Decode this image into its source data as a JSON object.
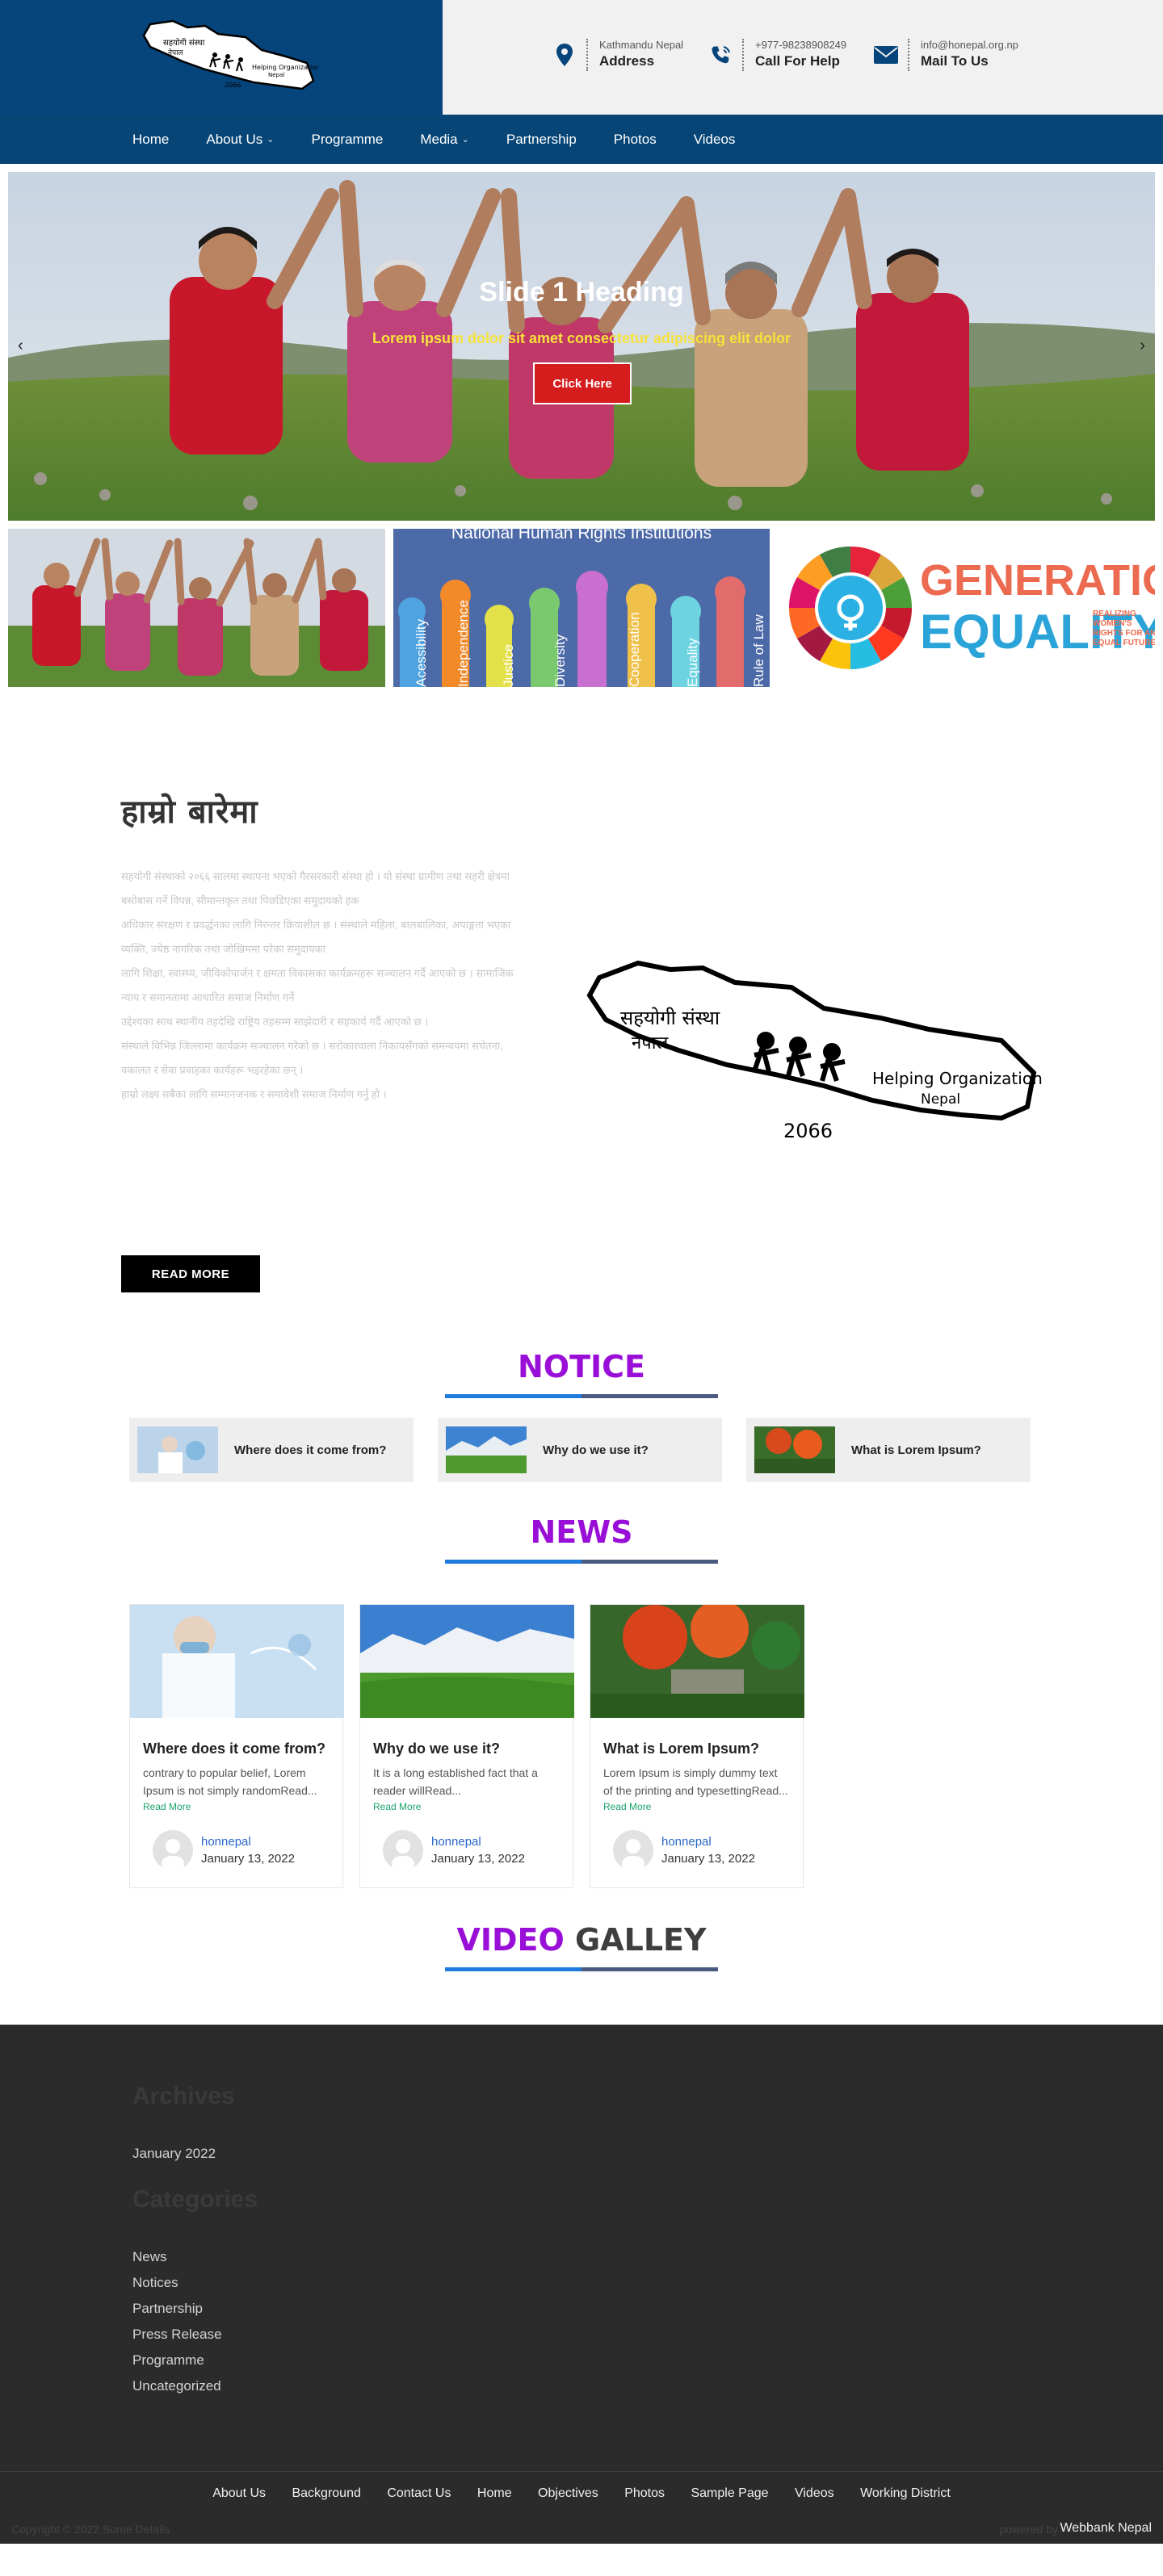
{
  "header": {
    "logo_nepali_line1": "सहयोगी संस्था",
    "logo_nepali_line2": "नेपाल",
    "logo_english": "Helping Organization",
    "logo_english2": "Nepal",
    "logo_year": "2066",
    "contacts": [
      {
        "icon": "map-pin-icon",
        "small": "Kathmandu Nepal",
        "big": "Address"
      },
      {
        "icon": "phone-icon",
        "small": "+977-98238908249",
        "big": "Call For Help"
      },
      {
        "icon": "envelope-icon",
        "small": "info@honepal.org.np",
        "big": "Mail To Us"
      }
    ]
  },
  "nav": {
    "items": [
      "Home",
      "About Us",
      "Programme",
      "Media",
      "Partnership",
      "Photos",
      "Videos"
    ]
  },
  "hero": {
    "title": "Slide 1 Heading",
    "subtitle": "Lorem ipsum dolor sit amet consectetur adipiscing elit dolor",
    "button": "Click Here",
    "prev": "‹",
    "next": "›"
  },
  "thumbs": {
    "nhri_title": "National Human Rights Institutions",
    "nhri_words": [
      "Acessibility",
      "Independence",
      "Justice",
      "Diversity",
      "Cooperation",
      "Equality",
      "Rule of Law"
    ],
    "gen_line1": "GENERATION",
    "gen_line2": "EQUALITY",
    "gen_small": [
      "REALIZING",
      "WOMEN'S",
      "RIGHTS FOR AN",
      "EQUAL FUTURE"
    ]
  },
  "about": {
    "title": "हाम्रो बारेमा",
    "body": [
      "सहयोगी संस्थाको २०६६ सालमा स्थापना भएको गैरसरकारी संस्था हो । यो संस्था ग्रामीण तथा सहरी क्षेत्रमा बसोबास गर्ने विपन्न, सीमान्तकृत तथा पिछडिएका समुदायको हक",
      "अधिकार संरक्षण र प्रवर्द्धनका लागि निरन्तर क्रियाशील छ । संस्थाले महिला, बालबालिका, अपाङ्गता भएका व्यक्ति, ज्येष्ठ नागरिक तथा जोखिममा परेका समुदायका",
      "लागि शिक्षा, स्वास्थ्य, जीविकोपार्जन र क्षमता विकासका कार्यक्रमहरू सञ्चालन गर्दै आएको छ । सामाजिक न्याय र समानतामा आधारित समाज निर्माण गर्ने",
      "उद्देश्यका साथ स्थानीय तहदेखि राष्ट्रिय तहसम्म साझेदारी र सहकार्य गर्दै आएको छ ।",
      "संस्थाले विभिन्न जिल्लामा कार्यक्रम सञ्चालन गरेको छ । सरोकारवाला निकायसँगको समन्वयमा सचेतना, वकालत र सेवा प्रवाहका कार्यहरू भइरहेका छन् ।",
      "हाम्रो लक्ष्य सबैका लागि सम्मानजनक र समावेशी समाज निर्माण गर्नु हो ।"
    ],
    "button": "READ MORE"
  },
  "notice": {
    "title_part1": "NOTICE",
    "items": [
      {
        "title": "Where does it come from?",
        "image": "doctor"
      },
      {
        "title": "Why do we use it?",
        "image": "mountain"
      },
      {
        "title": "What is Lorem Ipsum?",
        "image": "garden"
      }
    ]
  },
  "news": {
    "title_part1": "NEWS",
    "read_more": "Read More",
    "items": [
      {
        "title": "Where does it come from?",
        "excerpt": "contrary to popular belief, Lorem Ipsum is not simply randomRead...",
        "author": "honnepal",
        "date": "January 13, 2022",
        "image": "doctor"
      },
      {
        "title": "Why do we use it?",
        "excerpt": "It is a long established fact that a reader willRead...",
        "author": "honnepal",
        "date": "January 13, 2022",
        "image": "mountain"
      },
      {
        "title": "What is Lorem Ipsum?",
        "excerpt": "Lorem Ipsum is simply dummy text of the printing and typesettingRead...",
        "author": "honnepal",
        "date": "January 13, 2022",
        "image": "garden"
      }
    ]
  },
  "video": {
    "title_part1": "VIDEO",
    "title_part2": "GALLEY"
  },
  "footer": {
    "archives_title": "Archives",
    "archives": [
      "January 2022"
    ],
    "categories_title": "Categories",
    "categories": [
      "News",
      "Notices",
      "Partnership",
      "Press Release",
      "Programme",
      "Uncategorized"
    ],
    "bottom_links": [
      "About Us",
      "Background",
      "Contact Us",
      "Home",
      "Objectives",
      "Photos",
      "Sample Page",
      "Videos",
      "Working District"
    ],
    "copyright": "Copyright © 2022 Some Details",
    "powered_label": "powered by",
    "powered_by": "Webbank Nepal"
  },
  "colors": {
    "brand_blue": "#05457b",
    "nav_blue": "#064576",
    "accent_purple": "#9a0fd8",
    "button_red": "#d61d1d",
    "footer_bg": "#2b2b2b"
  }
}
